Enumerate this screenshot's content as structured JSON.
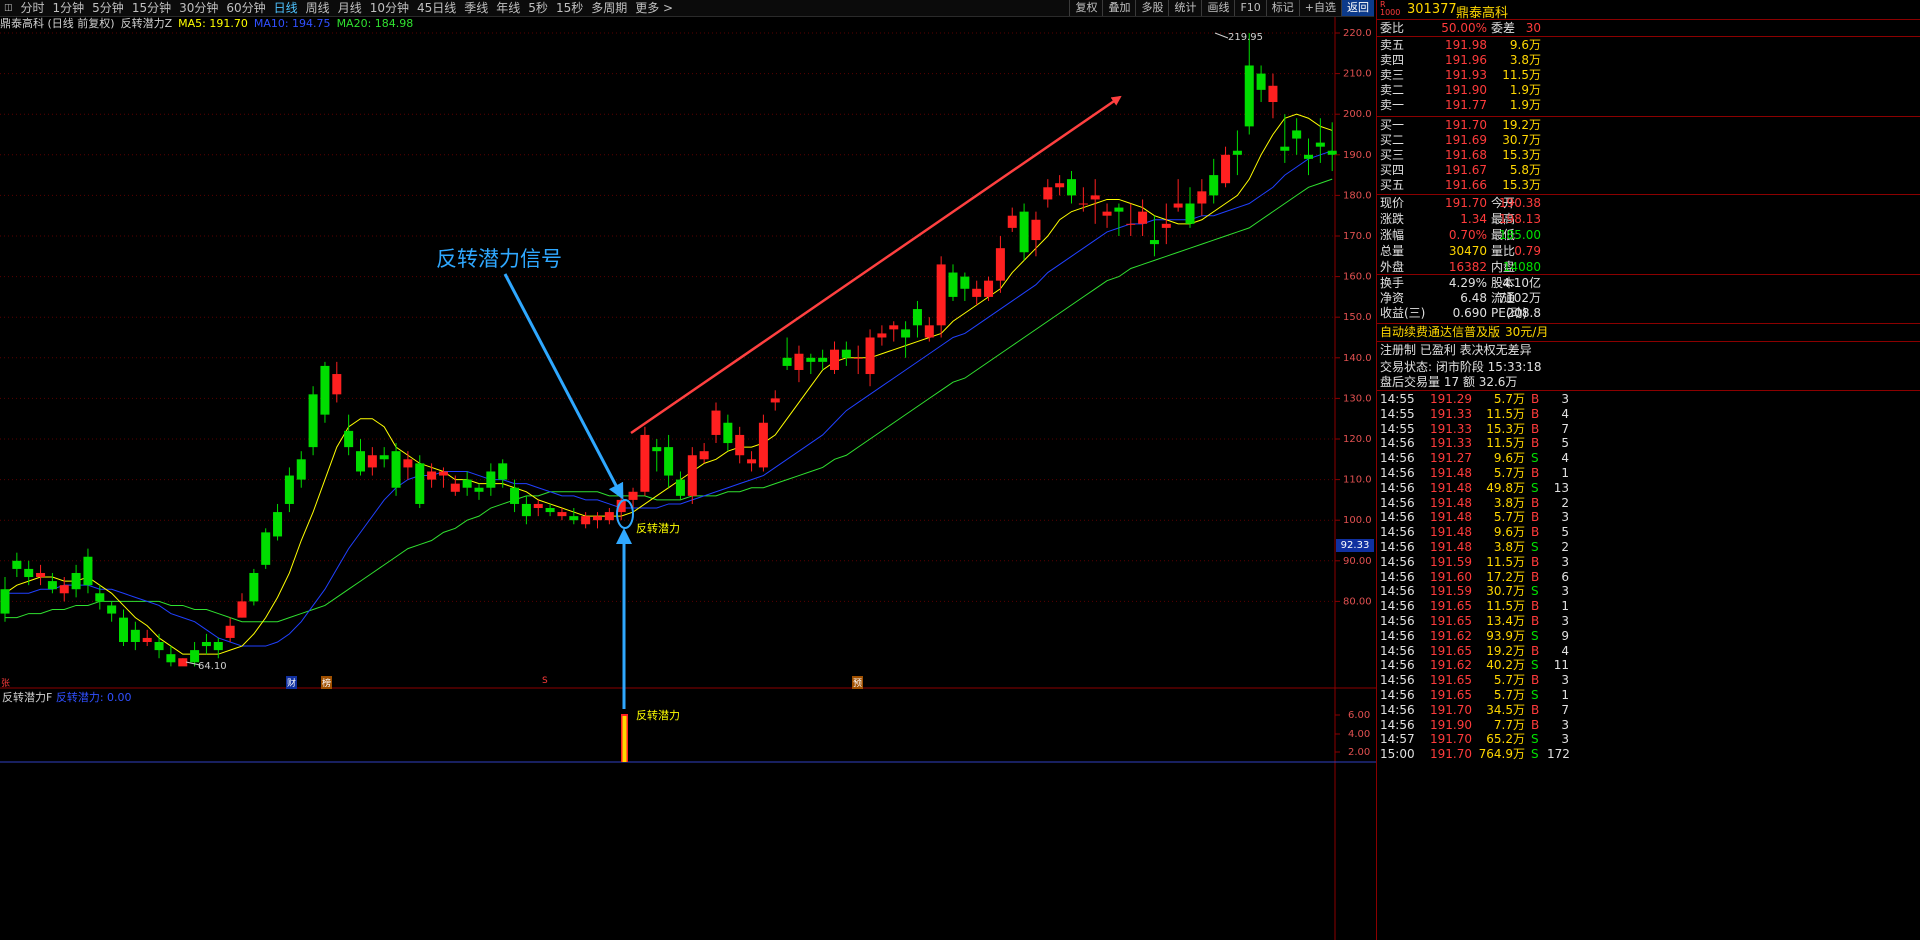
{
  "toolbar": {
    "periods": [
      "分时",
      "1分钟",
      "5分钟",
      "15分钟",
      "30分钟",
      "60分钟",
      "日线",
      "周线",
      "月线",
      "10分钟",
      "45日线",
      "季线",
      "年线",
      "5秒",
      "15秒",
      "多周期",
      "更多 >"
    ],
    "active_period": "日线",
    "right_buttons": [
      "复权",
      "叠加",
      "多股",
      "统计",
      "画线",
      "F10",
      "标记",
      "+自选",
      "返回"
    ]
  },
  "info": {
    "stock": "鼎泰高科 (日线 前复权)",
    "indicator": "反转潜力Z",
    "ma5": "MA5: 191.70",
    "ma10": "MA10: 194.75",
    "ma20": "MA20: 184.98"
  },
  "annotations": {
    "signal_title": "反转潜力信号",
    "signal_label": "反转潜力",
    "sub_signal_label": "反转潜力",
    "high_label": "219.95",
    "low_label": "64.10",
    "price_marker": "92.33",
    "markers": [
      "张",
      "财",
      "榜",
      "S",
      "预"
    ]
  },
  "sub_indicator": {
    "name": "反转潜力F",
    "value_label": "反转潜力: 0.00",
    "axis": [
      "6.00",
      "4.00",
      "2.00"
    ]
  },
  "price_axis": [
    "220.0",
    "210.0",
    "200.0",
    "190.0",
    "180.0",
    "170.0",
    "160.0",
    "150.0",
    "140.0",
    "130.0",
    "120.0",
    "110.0",
    "100.0",
    "90.00",
    "80.00"
  ],
  "colors": {
    "up": "#ff2020",
    "down": "#00dd00",
    "ma5": "#ffff00",
    "ma10": "#2040ff",
    "ma20": "#30e030",
    "arrow_red": "#ff4040",
    "arrow_blue": "#2fa8ff"
  },
  "chart_data": {
    "type": "candlestick",
    "ylim": [
      60,
      224
    ],
    "series": [
      {
        "name": "MA5",
        "values": []
      },
      {
        "name": "MA10",
        "values": []
      },
      {
        "name": "MA20",
        "values": []
      }
    ],
    "candles": [
      [
        83,
        77,
        86,
        75
      ],
      [
        90,
        88,
        92,
        86
      ],
      [
        88,
        86,
        90,
        84
      ],
      [
        86,
        87,
        89,
        84
      ],
      [
        85,
        83,
        87,
        82
      ],
      [
        82,
        84,
        86,
        80
      ],
      [
        87,
        83,
        89,
        81
      ],
      [
        91,
        84,
        93,
        82
      ],
      [
        82,
        80,
        84,
        78
      ],
      [
        79,
        77,
        80,
        75
      ],
      [
        76,
        70,
        78,
        69
      ],
      [
        73,
        70,
        75,
        68
      ],
      [
        70,
        71,
        73,
        69
      ],
      [
        70,
        68,
        72,
        66
      ],
      [
        67,
        65,
        69,
        64
      ],
      [
        64,
        66,
        66,
        64.1
      ],
      [
        68,
        65,
        70,
        64
      ],
      [
        70,
        69,
        72,
        67
      ],
      [
        70,
        68,
        71,
        66
      ],
      [
        71,
        74,
        76,
        70
      ],
      [
        76,
        80,
        82,
        76
      ],
      [
        87,
        80,
        88,
        79
      ],
      [
        97,
        89,
        98,
        88
      ],
      [
        102,
        96,
        104,
        95
      ],
      [
        111,
        104,
        113,
        102
      ],
      [
        115,
        110,
        117,
        108
      ],
      [
        131,
        118,
        133,
        116
      ],
      [
        138,
        126,
        139,
        124
      ],
      [
        131,
        136,
        139,
        129
      ],
      [
        122,
        118,
        126,
        116
      ],
      [
        117,
        112,
        120,
        111
      ],
      [
        113,
        116,
        118,
        111
      ],
      [
        116,
        115,
        118,
        113
      ],
      [
        117,
        108,
        119,
        106
      ],
      [
        113,
        115,
        117,
        110
      ],
      [
        114,
        104,
        116,
        103
      ],
      [
        110,
        112,
        114,
        108
      ],
      [
        111,
        112,
        113,
        108
      ],
      [
        107,
        109,
        111,
        106
      ],
      [
        110,
        108,
        112,
        106
      ],
      [
        108,
        107,
        109,
        105
      ],
      [
        112,
        108,
        114,
        106
      ],
      [
        114,
        110,
        115,
        108
      ],
      [
        108,
        104,
        110,
        102
      ],
      [
        104,
        101,
        106,
        99
      ],
      [
        103,
        104,
        105,
        101
      ],
      [
        103,
        102,
        104,
        101
      ],
      [
        101,
        102,
        103,
        100
      ],
      [
        101,
        100,
        103,
        99
      ],
      [
        99,
        101,
        102,
        98
      ],
      [
        100,
        101,
        102,
        98
      ],
      [
        100,
        102,
        103,
        99
      ],
      [
        102,
        105,
        106,
        100
      ],
      [
        105,
        107,
        108,
        103
      ],
      [
        107,
        121,
        123,
        106
      ],
      [
        118,
        117,
        120,
        112
      ],
      [
        118,
        111,
        121,
        108
      ],
      [
        110,
        106,
        112,
        105
      ],
      [
        106,
        116,
        118,
        104
      ],
      [
        115,
        117,
        119,
        114
      ],
      [
        121,
        127,
        129,
        119
      ],
      [
        124,
        119,
        126,
        117
      ],
      [
        116,
        121,
        123,
        114
      ],
      [
        114,
        115,
        117,
        112
      ],
      [
        113,
        124,
        126,
        112
      ],
      [
        129,
        130,
        132,
        127
      ],
      [
        140,
        138,
        145,
        137
      ],
      [
        137,
        141,
        143,
        134
      ],
      [
        140,
        139,
        141,
        136
      ],
      [
        140,
        139,
        142,
        137
      ],
      [
        137,
        142,
        144,
        136
      ],
      [
        142,
        140,
        144,
        138
      ],
      [
        140,
        140,
        143,
        136
      ],
      [
        136,
        145,
        147,
        133
      ],
      [
        145,
        146,
        148,
        143
      ],
      [
        147,
        148,
        149,
        144
      ],
      [
        147,
        145,
        149,
        140
      ],
      [
        152,
        148,
        154,
        145
      ],
      [
        145,
        148,
        150,
        144
      ],
      [
        148,
        163,
        165,
        145
      ],
      [
        161,
        155,
        163,
        154
      ],
      [
        160,
        157,
        161,
        154
      ],
      [
        155,
        157,
        159,
        153
      ],
      [
        155,
        159,
        160,
        154
      ],
      [
        159,
        167,
        170,
        156
      ],
      [
        172,
        175,
        177,
        171
      ],
      [
        176,
        166,
        178,
        164
      ],
      [
        169,
        174,
        176,
        165
      ],
      [
        179,
        182,
        184,
        177
      ],
      [
        182,
        183,
        185,
        180
      ],
      [
        184,
        180,
        186,
        178
      ],
      [
        178,
        178,
        182,
        176
      ],
      [
        179,
        180,
        184,
        173
      ],
      [
        175,
        176,
        178,
        172
      ],
      [
        177,
        176,
        178,
        170
      ],
      [
        173,
        173,
        178,
        170
      ],
      [
        173,
        176,
        179,
        170
      ],
      [
        169,
        168,
        175,
        165
      ],
      [
        172,
        173,
        178,
        168
      ],
      [
        177,
        178,
        184,
        176
      ],
      [
        178,
        173,
        182,
        172
      ],
      [
        178,
        181,
        184,
        175
      ],
      [
        185,
        180,
        189,
        178
      ],
      [
        183,
        190,
        192,
        182
      ],
      [
        191,
        190,
        196,
        185
      ],
      [
        212,
        197,
        220,
        195
      ],
      [
        210,
        206,
        212,
        203
      ],
      [
        203,
        207,
        210,
        199
      ],
      [
        192,
        191,
        200,
        188
      ],
      [
        196,
        194,
        199,
        190
      ],
      [
        190,
        189,
        194,
        185
      ],
      [
        193,
        192,
        199,
        188
      ],
      [
        191,
        190,
        198,
        186
      ]
    ],
    "ma5": [
      82,
      84,
      85,
      86,
      86,
      85,
      85,
      86,
      84,
      82,
      79,
      76,
      74,
      71,
      69,
      67,
      67,
      67,
      67,
      68,
      69,
      72,
      76,
      81,
      87,
      95,
      102,
      110,
      118,
      123,
      125,
      125,
      123,
      118,
      116,
      114,
      113,
      112,
      110,
      110,
      109,
      109,
      109,
      108,
      107,
      105,
      104,
      103,
      102,
      101,
      101,
      101,
      101,
      102,
      104,
      106,
      108,
      110,
      112,
      114,
      115,
      117,
      118,
      118,
      119,
      121,
      125,
      129,
      133,
      137,
      139,
      140,
      140,
      140,
      141,
      142,
      143,
      144,
      145,
      146,
      149,
      151,
      153,
      155,
      157,
      161,
      164,
      167,
      170,
      174,
      176,
      177,
      178,
      179,
      179,
      178,
      177,
      175,
      174,
      173,
      173,
      174,
      176,
      178,
      180,
      184,
      190,
      195,
      199,
      200,
      199,
      197,
      196
    ],
    "ma10": [
      82,
      82,
      82,
      83,
      83,
      84,
      84,
      84,
      83,
      83,
      82,
      81,
      80,
      79,
      77,
      76,
      75,
      73,
      71,
      70,
      69,
      69,
      69,
      70,
      72,
      75,
      79,
      83,
      88,
      93,
      97,
      101,
      105,
      108,
      110,
      111,
      111,
      112,
      112,
      112,
      111,
      110,
      110,
      109,
      109,
      108,
      107,
      106,
      106,
      105,
      105,
      104,
      103,
      103,
      103,
      103,
      104,
      104,
      105,
      106,
      107,
      108,
      109,
      110,
      111,
      113,
      115,
      117,
      119,
      121,
      124,
      127,
      129,
      131,
      133,
      135,
      137,
      139,
      141,
      143,
      145,
      146,
      148,
      150,
      152,
      154,
      156,
      158,
      161,
      163,
      165,
      167,
      169,
      171,
      172,
      173,
      173,
      174,
      174,
      174,
      174,
      175,
      175,
      176,
      177,
      178,
      180,
      182,
      185,
      187,
      189,
      190,
      191
    ],
    "ma20": [
      76,
      76,
      77,
      77,
      78,
      78,
      79,
      79,
      80,
      80,
      80,
      80,
      80,
      80,
      79,
      79,
      78,
      78,
      77,
      76,
      75,
      75,
      75,
      75,
      76,
      77,
      78,
      79,
      81,
      83,
      85,
      87,
      89,
      91,
      93,
      94,
      95,
      97,
      98,
      100,
      101,
      103,
      104,
      105,
      106,
      106,
      107,
      107,
      107,
      107,
      107,
      106,
      106,
      106,
      106,
      105,
      105,
      105,
      106,
      106,
      106,
      107,
      107,
      108,
      108,
      109,
      110,
      111,
      112,
      113,
      115,
      116,
      118,
      120,
      122,
      124,
      126,
      128,
      130,
      132,
      134,
      135,
      137,
      139,
      141,
      143,
      145,
      147,
      149,
      151,
      153,
      155,
      157,
      159,
      160,
      162,
      163,
      164,
      165,
      166,
      167,
      168,
      169,
      170,
      171,
      172,
      174,
      176,
      178,
      180,
      182,
      183,
      184
    ]
  },
  "quote": {
    "code": "301377",
    "name": "鼎泰高科",
    "weibi_label": "委比",
    "weibi": "50.00%",
    "weicha_label": "委差",
    "weicha": "30",
    "sell": [
      {
        "label": "卖五",
        "price": "191.98",
        "vol": "9.6万"
      },
      {
        "label": "卖四",
        "price": "191.96",
        "vol": "3.8万"
      },
      {
        "label": "卖三",
        "price": "191.93",
        "vol": "11.5万"
      },
      {
        "label": "卖二",
        "price": "191.90",
        "vol": "1.9万"
      },
      {
        "label": "卖一",
        "price": "191.77",
        "vol": "1.9万"
      }
    ],
    "buy": [
      {
        "label": "买一",
        "price": "191.70",
        "vol": "19.2万"
      },
      {
        "label": "买二",
        "price": "191.69",
        "vol": "30.7万"
      },
      {
        "label": "买三",
        "price": "191.68",
        "vol": "15.3万"
      },
      {
        "label": "买四",
        "price": "191.67",
        "vol": "5.8万"
      },
      {
        "label": "买五",
        "price": "191.66",
        "vol": "15.3万"
      }
    ],
    "stats": [
      [
        "现价",
        "191.70",
        "今开",
        "190.38"
      ],
      [
        "涨跌",
        "1.34",
        "最高",
        "198.13"
      ],
      [
        "涨幅",
        "0.70%",
        "最低",
        "185.00"
      ],
      [
        "总量",
        "30470",
        "量比",
        "0.79"
      ],
      [
        "外盘",
        "16382",
        "内盘",
        "14080"
      ]
    ],
    "fund": [
      [
        "换手",
        "4.29%",
        "股本",
        "4.10亿"
      ],
      [
        "净资",
        "6.48",
        "流通",
        "7102万"
      ],
      [
        "收益(三)",
        "0.690",
        "PE(动)",
        "208.8"
      ]
    ],
    "ad_text": "自动续费通达信普及版",
    "ad_price": "30元/月",
    "reg_text": "注册制 已盈利 表决权无差异",
    "trade_status": "交易状态: 闭市阶段 15:33:18",
    "after_trade": "盘后交易量 17 额 32.6万"
  },
  "ticks": [
    [
      "14:55",
      "191.29",
      "5.7万",
      "B",
      "3"
    ],
    [
      "14:55",
      "191.33",
      "11.5万",
      "B",
      "4"
    ],
    [
      "14:55",
      "191.33",
      "15.3万",
      "B",
      "7"
    ],
    [
      "14:56",
      "191.33",
      "11.5万",
      "B",
      "5"
    ],
    [
      "14:56",
      "191.27",
      "9.6万",
      "S",
      "4"
    ],
    [
      "14:56",
      "191.48",
      "5.7万",
      "B",
      "1"
    ],
    [
      "14:56",
      "191.48",
      "49.8万",
      "S",
      "13"
    ],
    [
      "14:56",
      "191.48",
      "3.8万",
      "B",
      "2"
    ],
    [
      "14:56",
      "191.48",
      "5.7万",
      "B",
      "3"
    ],
    [
      "14:56",
      "191.48",
      "9.6万",
      "B",
      "5"
    ],
    [
      "14:56",
      "191.48",
      "3.8万",
      "S",
      "2"
    ],
    [
      "14:56",
      "191.59",
      "11.5万",
      "B",
      "3"
    ],
    [
      "14:56",
      "191.60",
      "17.2万",
      "B",
      "6"
    ],
    [
      "14:56",
      "191.59",
      "30.7万",
      "S",
      "3"
    ],
    [
      "14:56",
      "191.65",
      "11.5万",
      "B",
      "1"
    ],
    [
      "14:56",
      "191.65",
      "13.4万",
      "B",
      "3"
    ],
    [
      "14:56",
      "191.62",
      "93.9万",
      "S",
      "9"
    ],
    [
      "14:56",
      "191.65",
      "19.2万",
      "B",
      "4"
    ],
    [
      "14:56",
      "191.62",
      "40.2万",
      "S",
      "11"
    ],
    [
      "14:56",
      "191.65",
      "5.7万",
      "B",
      "3"
    ],
    [
      "14:56",
      "191.65",
      "5.7万",
      "S",
      "1"
    ],
    [
      "14:56",
      "191.70",
      "34.5万",
      "B",
      "7"
    ],
    [
      "14:56",
      "191.90",
      "7.7万",
      "B",
      "3"
    ],
    [
      "14:57",
      "191.70",
      "65.2万",
      "S",
      "3"
    ],
    [
      "15:00",
      "191.70",
      "764.9万",
      "S",
      "172"
    ]
  ]
}
